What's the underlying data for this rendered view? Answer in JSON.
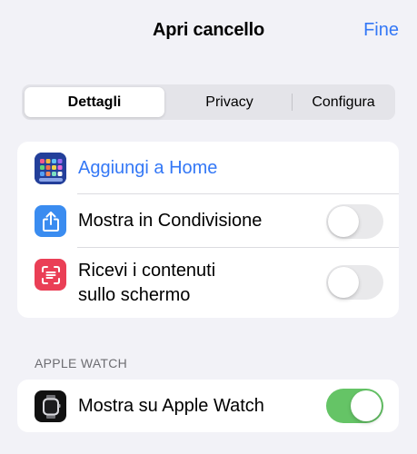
{
  "navbar": {
    "title": "Apri cancello",
    "done_label": "Fine"
  },
  "segments": [
    {
      "label": "Dettagli",
      "selected": true
    },
    {
      "label": "Privacy",
      "selected": false
    },
    {
      "label": "Configura",
      "selected": false
    }
  ],
  "details": {
    "add_to_home": {
      "label": "Aggiungi a Home",
      "icon": "home-screen-grid-icon"
    },
    "show_in_share": {
      "label": "Mostra in Condivisione",
      "icon": "share-icon",
      "toggle_on": false
    },
    "receive_screen": {
      "label_line1": "Ricevi i contenuti",
      "label_line2": "sullo schermo",
      "icon": "screen-content-icon",
      "toggle_on": false
    }
  },
  "apple_watch": {
    "section_header": "APPLE WATCH",
    "show_on_watch": {
      "label": "Mostra su Apple Watch",
      "icon": "apple-watch-icon",
      "toggle_on": true
    }
  },
  "colors": {
    "accent": "#3478f6",
    "toggle_on": "#65c466",
    "background": "#f2f2f7",
    "share_icon_bg": "#3a8cf0",
    "screen_icon_bg": "#ea3f56"
  }
}
